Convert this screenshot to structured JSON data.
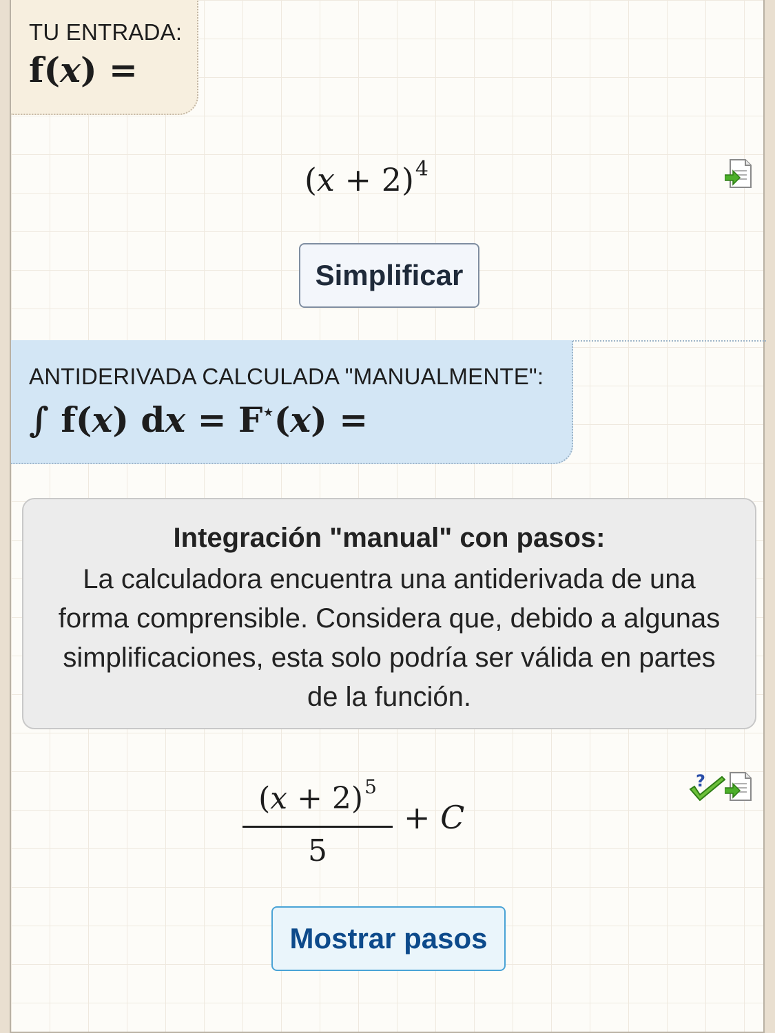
{
  "input_section": {
    "caption": "TU ENTRADA:",
    "label": "f(x) =",
    "expression": {
      "base": "(x + 2)",
      "exponent": "4"
    },
    "simplify_button": "Simplificar"
  },
  "antiderivative_section": {
    "caption": "ANTIDERIVADA CALCULADA \"MANUALMENTE\":",
    "label": "∫ f(x) dx = F⋆(x) ="
  },
  "info_box": {
    "title": "Integración \"manual\" con pasos:",
    "body": "La calculadora encuentra una antiderivada de una forma comprensible. Considera que, debido a algunas simplificaciones, esta solo podría ser válida en partes de la función."
  },
  "result": {
    "numerator_base": "(x + 2)",
    "numerator_exponent": "5",
    "denominator": "5",
    "constant": "+ C",
    "show_steps_button": "Mostrar pasos"
  },
  "icons": {
    "export": "document-export-icon",
    "verify": "question-check-icon",
    "accent_green": "#4caf2a",
    "accent_blue": "#4aa3d6"
  }
}
